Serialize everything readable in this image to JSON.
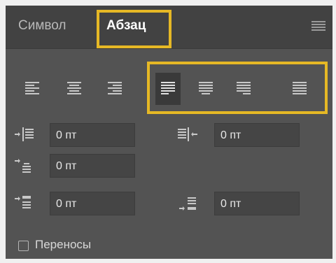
{
  "tabs": [
    {
      "label": "Символ",
      "active": false
    },
    {
      "label": "Абзац",
      "active": true
    }
  ],
  "alignment": {
    "buttons": [
      {
        "name": "align-left-icon",
        "active": false
      },
      {
        "name": "align-center-icon",
        "active": false
      },
      {
        "name": "align-right-icon",
        "active": false
      },
      {
        "name": "justify-last-left-icon",
        "active": true
      },
      {
        "name": "justify-last-center-icon",
        "active": false
      },
      {
        "name": "justify-last-right-icon",
        "active": false
      },
      {
        "name": "justify-all-icon",
        "active": false
      }
    ]
  },
  "fields": {
    "left_indent": "0 пт",
    "right_indent": "0 пт",
    "first_line_indent": "0 пт",
    "space_before": "0 пт",
    "space_after": "0 пт"
  },
  "hyphenation": {
    "label": "Переносы",
    "checked": false
  },
  "colors": {
    "highlight": "#e6b825",
    "panel": "#535353",
    "tabbar": "#424242"
  }
}
